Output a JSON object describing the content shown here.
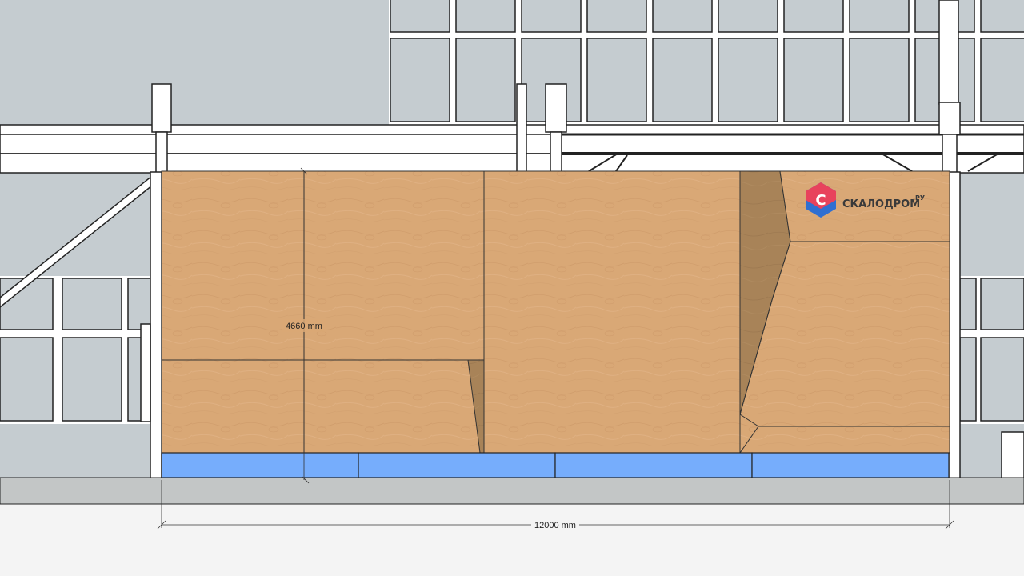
{
  "dimensions": {
    "height_label": "4660 mm",
    "width_label": "12000 mm"
  },
  "logo": {
    "icon": "skalodrom-logo-icon",
    "name": "СКАЛОДРОМ",
    "suffix": ".РУ",
    "colors": {
      "primary": "#e8425c",
      "secondary": "#2f6fd1"
    }
  },
  "colors": {
    "background": "#c5ccd0",
    "plywood": "#d9a876",
    "plywood_shadow": "#a88358",
    "mats": "#76adfc",
    "floor": "#c3c6c6",
    "structure": "#ffffff"
  }
}
